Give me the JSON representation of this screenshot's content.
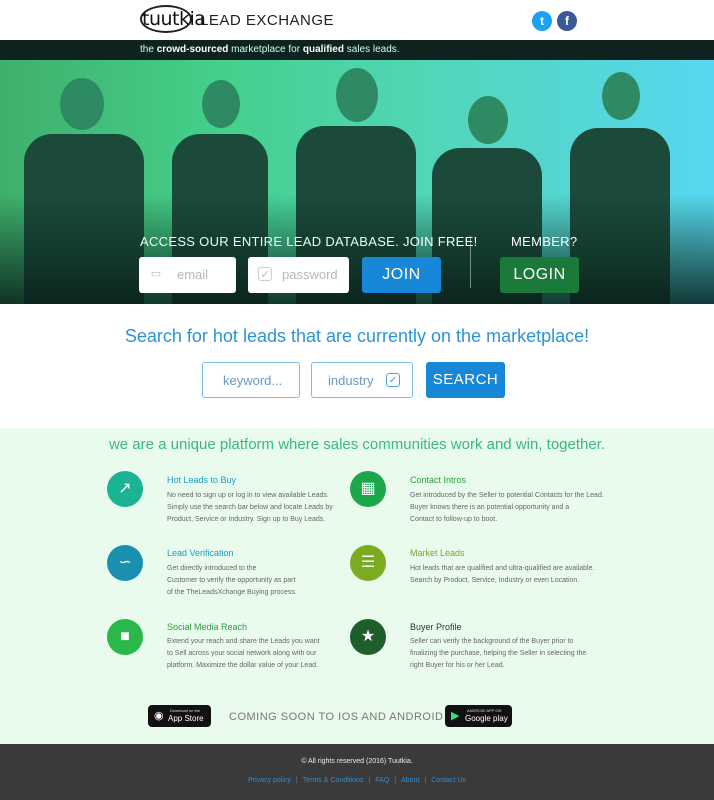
{
  "header": {
    "logo_word": "tuutkia",
    "logo_sub": "LEAD EXCHANGE",
    "tagline_pre": "the ",
    "tagline_b1": "crowd-sourced",
    "tagline_mid": " marketplace for ",
    "tagline_b2": "qualified",
    "tagline_post": " sales leads.",
    "social_twitter_icon": "twitter-icon",
    "social_facebook_icon": "facebook-icon"
  },
  "hero": {
    "access_text": "ACCESS OUR ENTIRE LEAD DATABASE.",
    "join_free": "JOIN FREE!",
    "member_text": "MEMBER?",
    "email_placeholder": "email",
    "password_placeholder": "password",
    "join_label": "JOIN",
    "login_label": "LOGIN"
  },
  "search": {
    "title": "Search for hot leads that are currently on the marketplace!",
    "keyword_placeholder": "keyword...",
    "industry_placeholder": "industry",
    "search_label": "SEARCH"
  },
  "features": {
    "title": "we are a unique platform where sales communities work and win, together.",
    "items": [
      {
        "title": "Hot Leads to Buy",
        "desc": [
          "No need to sign up or log in to view available Leads.",
          "Simply use the search bar below and locate Leads by",
          "Product, Service or Industry. Sign up to Buy Leads."
        ],
        "icon": "chart-icon",
        "color": "#1ab394"
      },
      {
        "title": "Contact Intros",
        "desc": [
          "Get introduced by the Seller to potential Contacts for the Lead.",
          "Buyer knows there is an potential opportunity and a",
          "Contact to follow-up to boot."
        ],
        "icon": "calendar-icon",
        "color": "#1aa84a"
      },
      {
        "title": "Lead Verification",
        "desc": [
          "Get directly introduced to the",
          "Customer to verify the opportunity as part",
          "of the TheLeadsXchange Buying process."
        ],
        "icon": "mustache-icon",
        "color": "#1b8fb0"
      },
      {
        "title": "Market Leads",
        "desc": [
          "Hot leads that are qualified and ultra-qualified are available.",
          "Search by Product, Service, Industry or even Location."
        ],
        "icon": "coins-icon",
        "color": "#7bab1e"
      },
      {
        "title": "Social Media Reach",
        "desc": [
          "Extend your reach and share the Leads you want",
          "to Sell across your social network along with our",
          "platform. Maximize the dollar value of your Lead."
        ],
        "icon": "lock-icon",
        "color": "#2bb84a"
      },
      {
        "title": "Buyer Profile",
        "desc": [
          "Seller can verify the background of the Buyer prior to",
          "finalizing the purchase, helping the Seller in selecting the",
          "right Buyer for his or her Lead."
        ],
        "icon": "trophy-icon",
        "color": "#1d5e2a"
      }
    ]
  },
  "apps": {
    "appstore_small": "Download on the",
    "appstore_large": "App Store",
    "coming_soon": "COMING SOON TO IOS AND ANDROID",
    "googleplay_small": "ANDROID APP ON",
    "googleplay_large": "Google play"
  },
  "footer": {
    "copyright": "© All rights reserved (2016) Tuutkia.",
    "links": [
      "Privacy policy",
      "Terms & Conditions",
      "FAQ",
      "About",
      "Contact Us"
    ]
  }
}
